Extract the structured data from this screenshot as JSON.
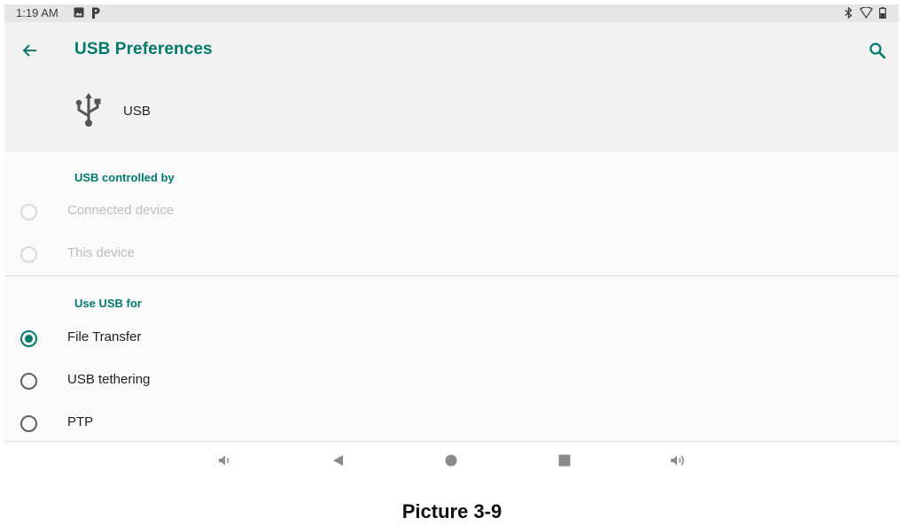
{
  "status_bar": {
    "time": "1:19 AM",
    "left_icons": [
      "image-notification-icon",
      "p-notification-icon"
    ],
    "right_icons": [
      "bluetooth-icon",
      "wifi-icon",
      "battery-icon"
    ]
  },
  "app_bar": {
    "title": "USB Preferences",
    "back_icon": "arrow-back-icon",
    "search_icon": "search-icon",
    "accent": "#00796b"
  },
  "usb_header": {
    "icon": "usb-icon",
    "label": "USB"
  },
  "usb_controlled_by": {
    "title": "USB controlled by",
    "options": [
      {
        "label": "Connected device",
        "selected": false,
        "enabled": false
      },
      {
        "label": "This device",
        "selected": false,
        "enabled": false
      }
    ]
  },
  "use_usb_for": {
    "title": "Use USB for",
    "options": [
      {
        "label": "File Transfer",
        "selected": true,
        "enabled": true
      },
      {
        "label": "USB tethering",
        "selected": false,
        "enabled": true
      },
      {
        "label": "PTP",
        "selected": false,
        "enabled": true
      }
    ]
  },
  "nav_bar": {
    "buttons": [
      "volume-down-icon",
      "back-triangle-icon",
      "home-circle-icon",
      "recents-square-icon",
      "volume-up-icon"
    ]
  },
  "caption": "Picture 3-9"
}
